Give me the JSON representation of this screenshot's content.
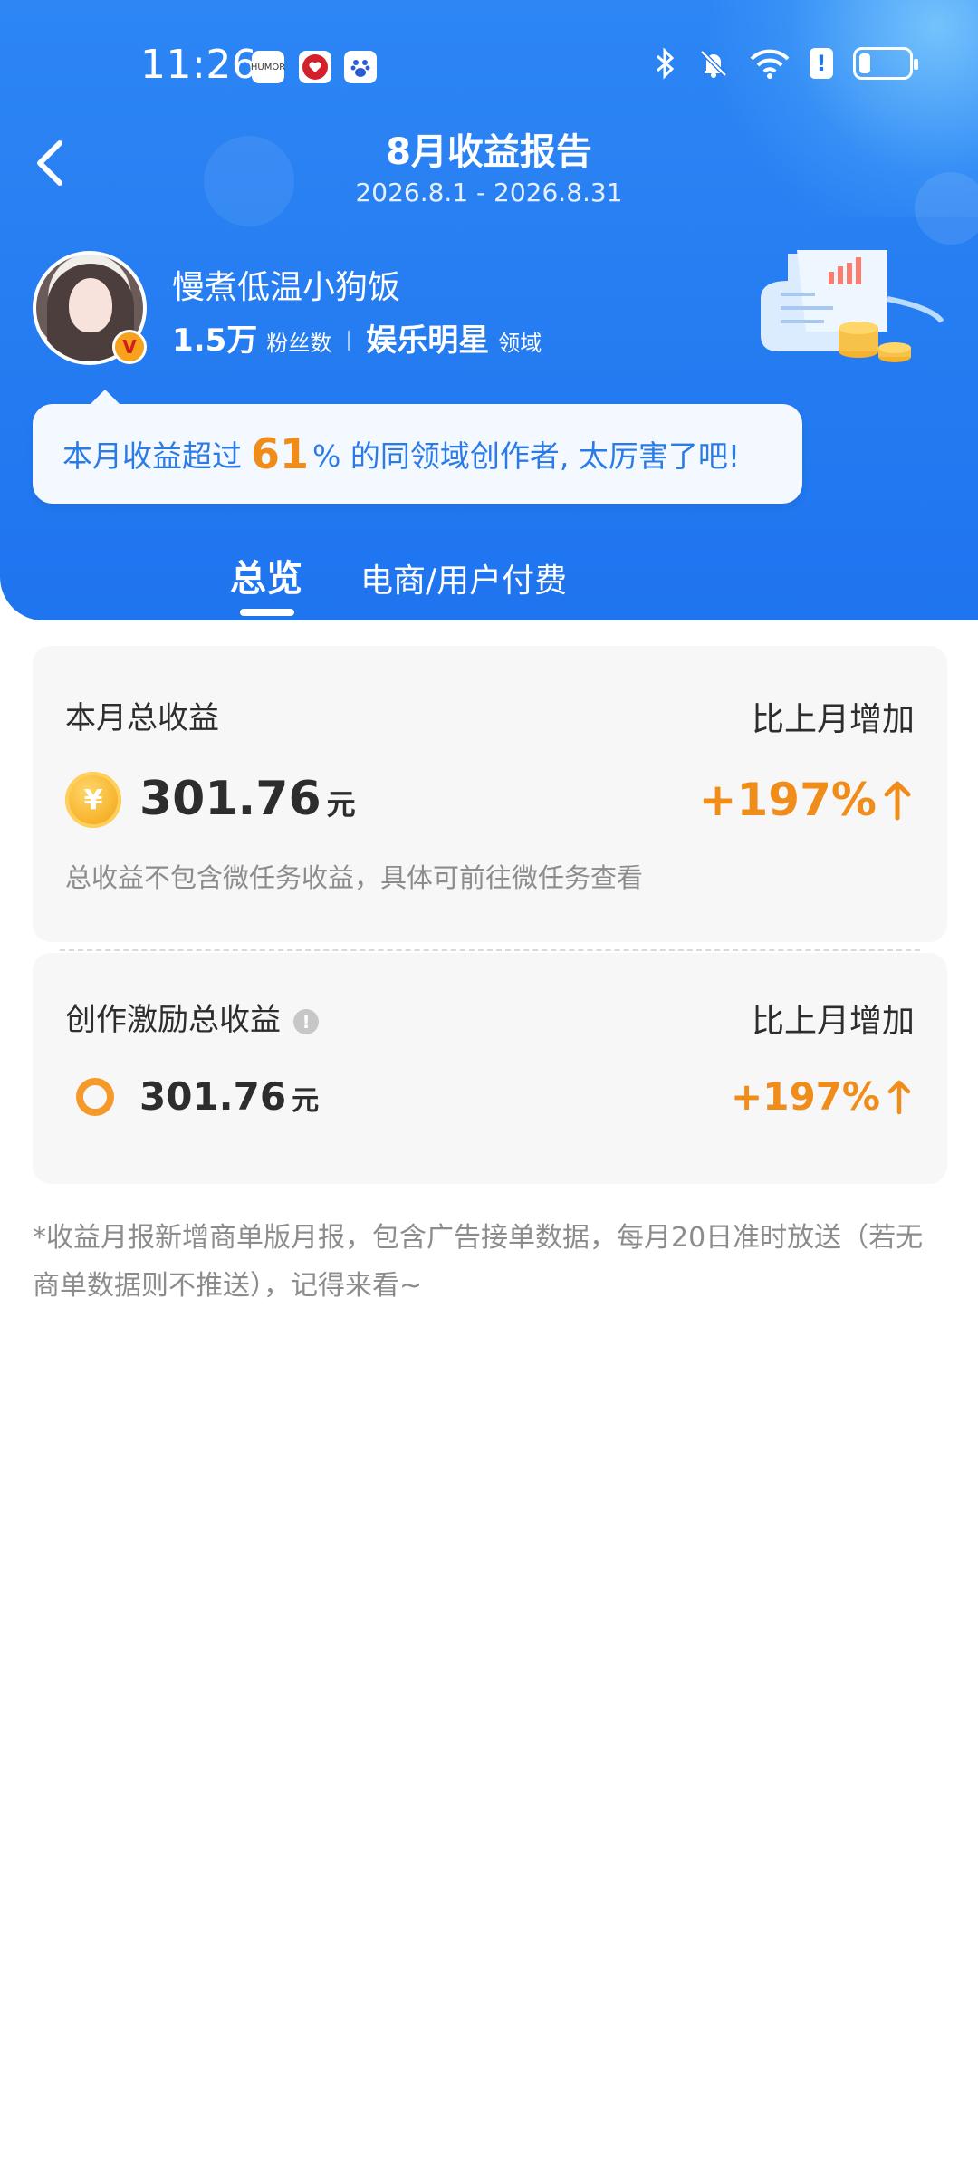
{
  "status_bar": {
    "time": "11:26",
    "apps": [
      "HUMOR",
      "heart-app",
      "baidu-app"
    ],
    "icons": [
      "bluetooth-icon",
      "mute-bell-icon",
      "wifi-icon",
      "alert-icon",
      "battery-icon"
    ]
  },
  "header": {
    "title": "8月收益报告",
    "date_range": "2026.8.1 - 2026.8.31"
  },
  "profile": {
    "username": "慢煮低温小狗饭",
    "fans_count": "1.5万",
    "fans_label": "粉丝数",
    "domain_name": "娱乐明星",
    "domain_label": "领域",
    "badge": "V"
  },
  "bubble": {
    "prefix": "本月收益超过",
    "percent": "61",
    "suffix": "% 的同领域创作者, 太厉害了吧!"
  },
  "tabs": [
    {
      "label": "总览",
      "active": true
    },
    {
      "label": "电商/用户付费",
      "active": false
    }
  ],
  "total_card": {
    "title": "本月总收益",
    "compare_label": "比上月增加",
    "coin_symbol": "¥",
    "amount": "301.76",
    "unit": "元",
    "growth": "+197%",
    "note": "总收益不包含微任务收益，具体可前往微任务查看"
  },
  "incentive_card": {
    "title": "创作激励总收益",
    "info_symbol": "!",
    "compare_label": "比上月增加",
    "amount": "301.76",
    "unit": "元",
    "growth": "+197%"
  },
  "footer_note": "*收益月报新增商单版月报，包含广告接单数据，每月20日准时放送（若无商单数据则不推送），记得来看~",
  "colors": {
    "header_blue": "#1f74ef",
    "accent_orange": "#f08d1a",
    "bubble_text": "#2b7be6"
  }
}
